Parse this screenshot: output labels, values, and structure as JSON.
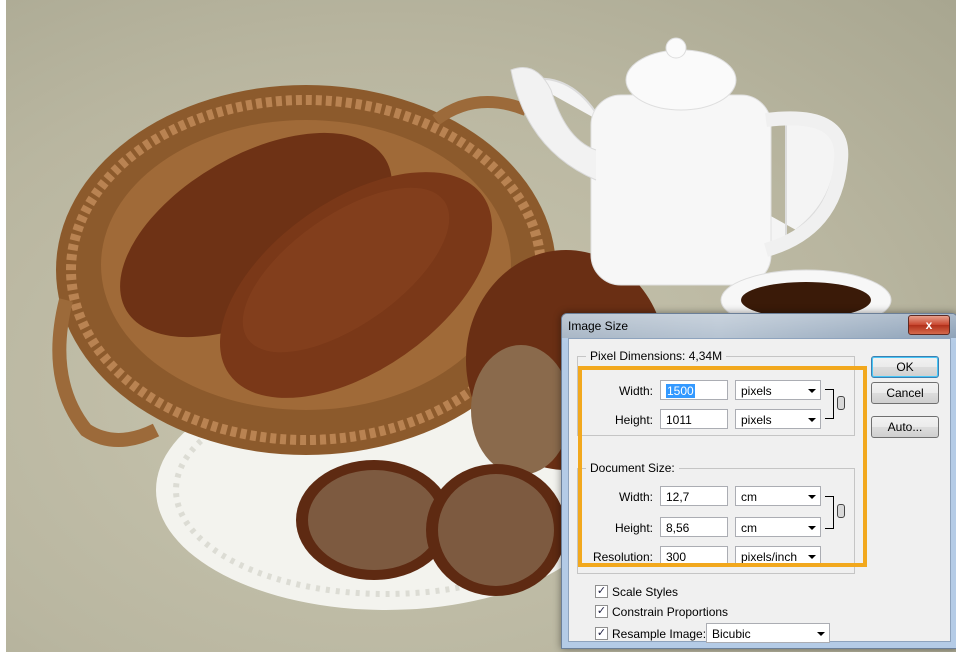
{
  "dialog": {
    "title": "Image Size",
    "close_label": "x",
    "pixel_dimensions": {
      "legend": "Pixel Dimensions:",
      "size": "4,34M",
      "width_label": "Width:",
      "width_value": "1500",
      "width_unit": "pixels",
      "height_label": "Height:",
      "height_value": "1011",
      "height_unit": "pixels"
    },
    "document_size": {
      "legend": "Document Size:",
      "width_label": "Width:",
      "width_value": "12,7",
      "width_unit": "cm",
      "height_label": "Height:",
      "height_value": "8,56",
      "height_unit": "cm",
      "resolution_label": "Resolution:",
      "resolution_value": "300",
      "resolution_unit": "pixels/inch"
    },
    "buttons": {
      "ok": "OK",
      "cancel": "Cancel",
      "auto": "Auto..."
    },
    "options": {
      "scale_styles": "Scale Styles",
      "constrain_proportions": "Constrain Proportions",
      "resample_image": "Resample Image:",
      "resample_method": "Bicubic"
    },
    "check_mark": "✓"
  },
  "colors": {
    "highlight": "#f2a81d"
  },
  "icons": [
    "chain-link-icon",
    "dropdown-arrow-icon",
    "close-icon",
    "checkbox-icon"
  ]
}
